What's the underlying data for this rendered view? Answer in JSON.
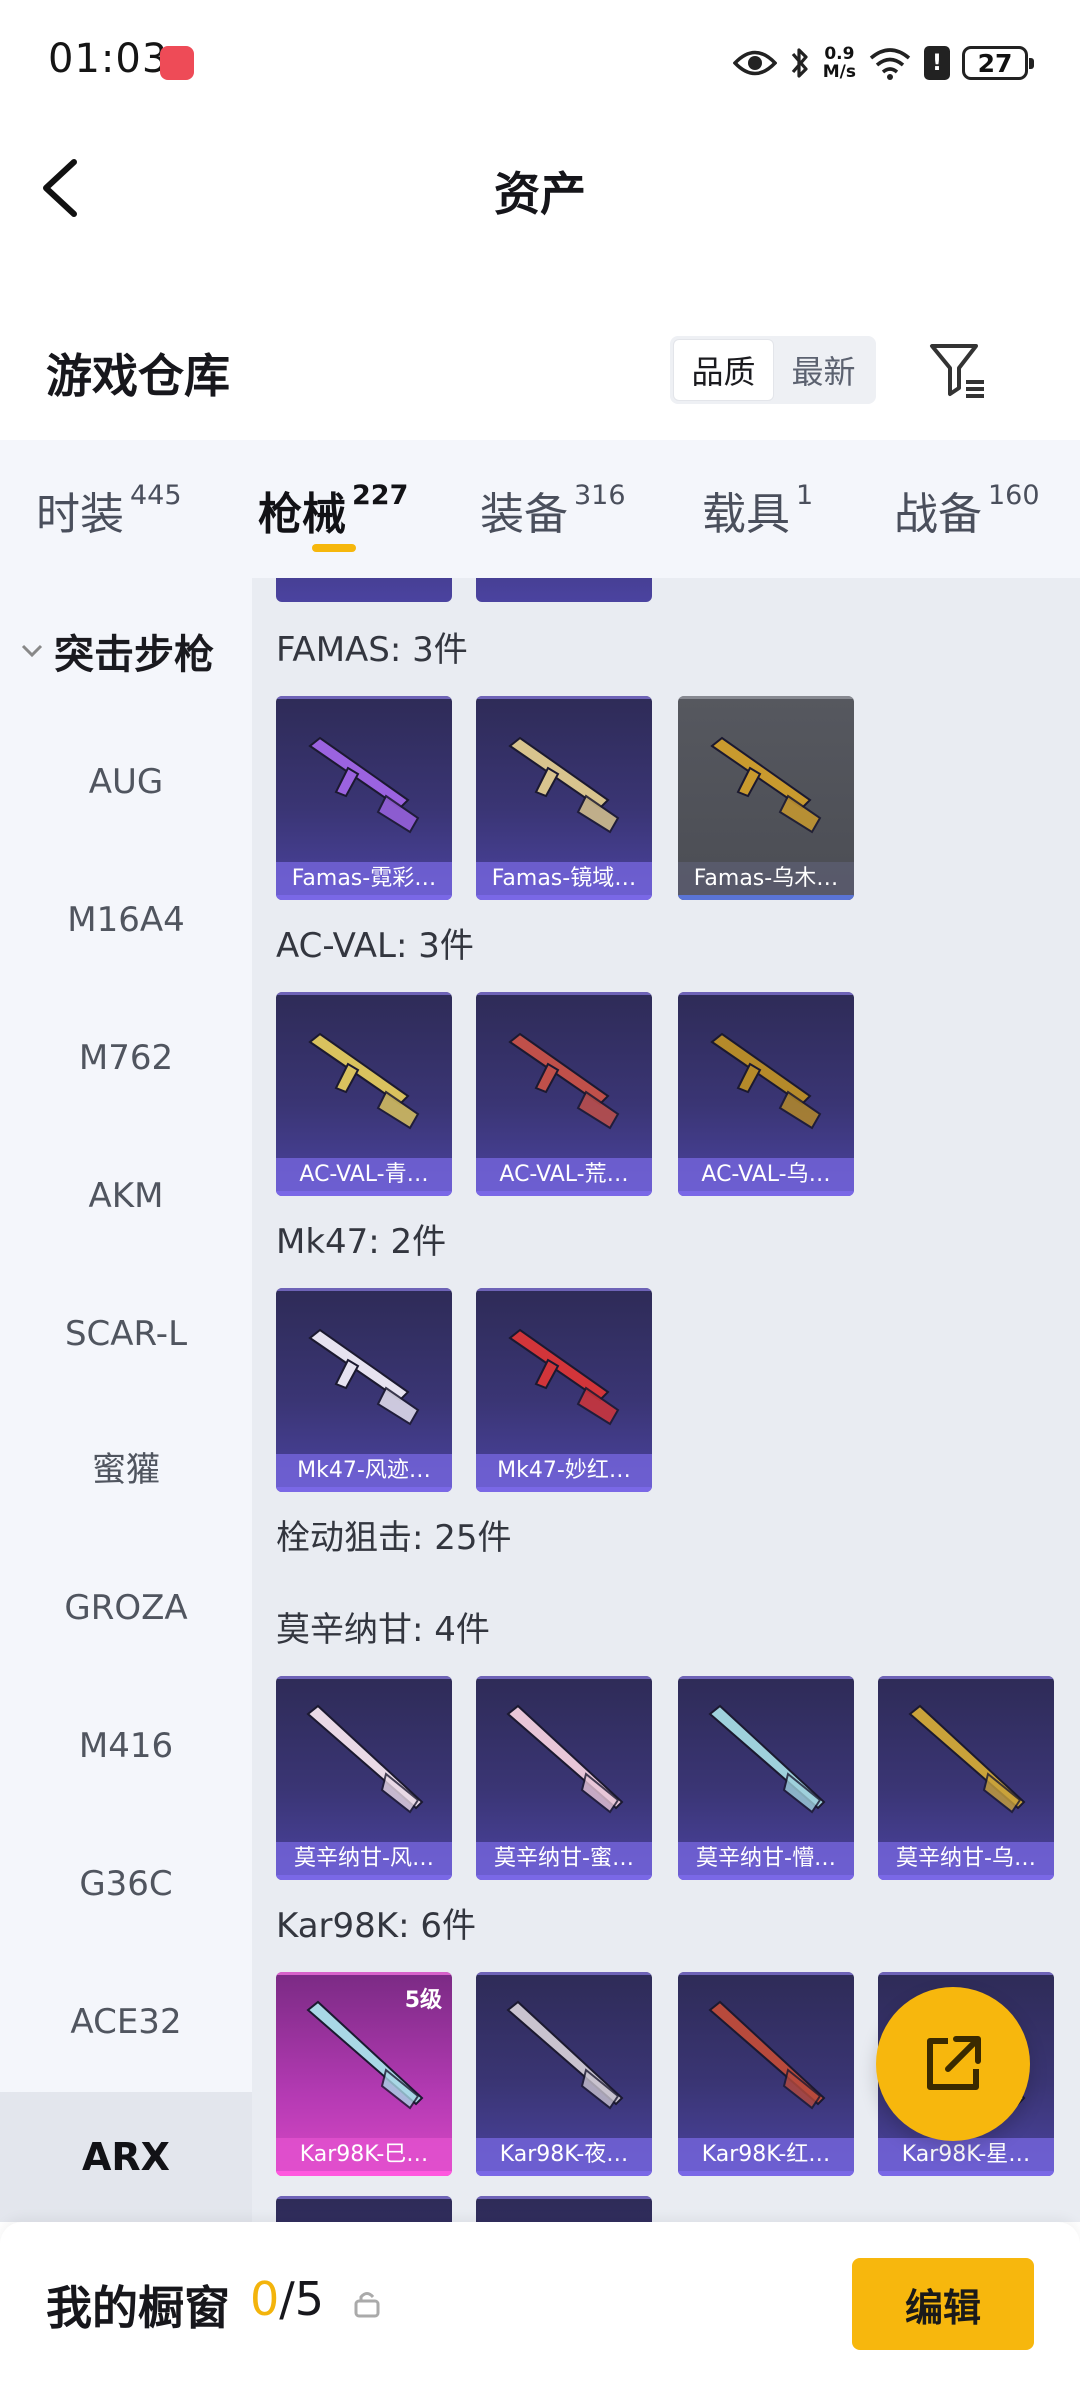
{
  "status_bar": {
    "time": "01:03",
    "speed_value": "0.9",
    "speed_unit": "M/s",
    "alert": "!",
    "battery": "27"
  },
  "header": {
    "title": "资产"
  },
  "section": {
    "title": "游戏仓库",
    "sort_options": [
      "品质",
      "最新"
    ],
    "sort_active": 0
  },
  "tabs": [
    {
      "label": "时装",
      "count": "445"
    },
    {
      "label": "枪械",
      "count": "227"
    },
    {
      "label": "装备",
      "count": "316"
    },
    {
      "label": "载具",
      "count": "1"
    },
    {
      "label": "战备",
      "count": "160"
    }
  ],
  "active_tab": 1,
  "sidebar": {
    "group_label": "突击步枪",
    "items": [
      "AUG",
      "M16A4",
      "M762",
      "AKM",
      "SCAR-L",
      "蜜獾",
      "GROZA",
      "M416",
      "G36C",
      "ACE32",
      "ARX"
    ],
    "active_item": "ARX"
  },
  "groups": [
    {
      "label": "FAMAS: 3件",
      "items": [
        {
          "name": "Famas-霓彩…",
          "style": "purple",
          "gun_color": "#9b63e0"
        },
        {
          "name": "Famas-镜域…",
          "style": "purple",
          "gun_color": "#d8c48e"
        },
        {
          "name": "Famas-乌木…",
          "style": "grey",
          "gun_color": "#c99a2e"
        }
      ]
    },
    {
      "label": "AC-VAL: 3件",
      "items": [
        {
          "name": "AC-VAL-青…",
          "style": "purple",
          "gun_color": "#d9c25e"
        },
        {
          "name": "AC-VAL-荒…",
          "style": "purple",
          "gun_color": "#c0504a"
        },
        {
          "name": "AC-VAL-乌…",
          "style": "purple",
          "gun_color": "#b58a2a"
        }
      ]
    },
    {
      "label": "Mk47: 2件",
      "items": [
        {
          "name": "Mk47-风迹…",
          "style": "purple",
          "gun_color": "#e6e2f0"
        },
        {
          "name": "Mk47-妙红…",
          "style": "purple",
          "gun_color": "#d2353a"
        }
      ]
    },
    {
      "label": "栓动狙击: 25件",
      "items": []
    },
    {
      "label": "莫辛纳甘: 4件",
      "items": [
        {
          "name": "莫辛纳甘-风…",
          "style": "purple",
          "gun_color": "#e9d9e6"
        },
        {
          "name": "莫辛纳甘-蜜…",
          "style": "purple",
          "gun_color": "#e8c6d8"
        },
        {
          "name": "莫辛纳甘-懵…",
          "style": "purple",
          "gun_color": "#9fd1dc"
        },
        {
          "name": "莫辛纳甘-乌…",
          "style": "purple",
          "gun_color": "#c9a23a"
        }
      ]
    },
    {
      "label": "Kar98K: 6件",
      "items": [
        {
          "name": "Kar98K-巳…",
          "style": "pink",
          "gun_color": "#a9d8e6",
          "badge": "5级"
        },
        {
          "name": "Kar98K-夜…",
          "style": "purple",
          "gun_color": "#c9c3cf"
        },
        {
          "name": "Kar98K-红…",
          "style": "purple",
          "gun_color": "#b84a3c"
        },
        {
          "name": "Kar98K-星…",
          "style": "purple",
          "gun_color": "#c7cde0"
        }
      ]
    }
  ],
  "bottom_bar": {
    "label": "我的橱窗",
    "used": "0",
    "total": "/5",
    "edit_label": "编辑"
  }
}
